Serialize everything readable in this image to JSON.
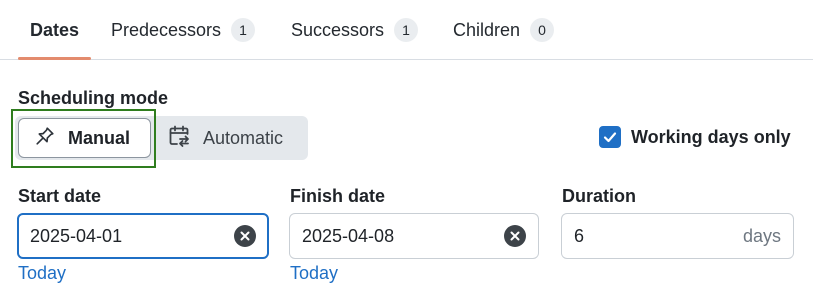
{
  "tabs": [
    {
      "label": "Dates",
      "count": null
    },
    {
      "label": "Predecessors",
      "count": "1"
    },
    {
      "label": "Successors",
      "count": "1"
    },
    {
      "label": "Children",
      "count": "0"
    }
  ],
  "active_tab": "Dates",
  "scheduling": {
    "label": "Scheduling mode",
    "manual_label": "Manual",
    "automatic_label": "Automatic",
    "selected": "Manual"
  },
  "working_days": {
    "label": "Working days only",
    "checked": true
  },
  "start_date": {
    "label": "Start date",
    "value": "2025-04-01",
    "today_label": "Today"
  },
  "finish_date": {
    "label": "Finish date",
    "value": "2025-04-08",
    "today_label": "Today"
  },
  "duration": {
    "label": "Duration",
    "value": "6",
    "unit": "days"
  },
  "colors": {
    "accent": "#1f6fc5",
    "tab_underline": "#e38b6d",
    "focus_outline": "#2f7d1e"
  }
}
